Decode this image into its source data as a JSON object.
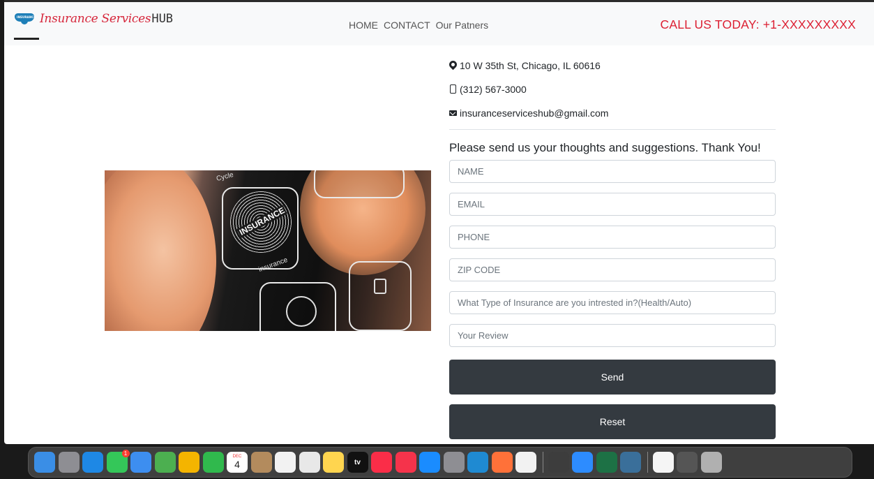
{
  "navbar": {
    "brand_script": "Insurance Services",
    "brand_hub": "HUB",
    "logo_tag": "INSURANCE",
    "links": [
      "HOME",
      "CONTACT",
      "Our Patners"
    ],
    "phone_cta": "CALL US TODAY: +1-XXXXXXXXX"
  },
  "hero": {
    "cycle_text": "Cycle",
    "insurance_badge": "INSURANCE",
    "insurance_sub": "insurance"
  },
  "contact": {
    "address": "10 W 35th St, Chicago, IL 60616",
    "phone": "(312) 567-3000",
    "email": "insuranceserviceshub@gmail.com",
    "icons": [
      "map-marker-icon",
      "mobile-icon",
      "envelope-icon"
    ]
  },
  "form": {
    "title": "Please send us your thoughts and suggestions. Thank You!",
    "name_placeholder": "NAME",
    "email_placeholder": "EMAIL",
    "phone_placeholder": "PHONE",
    "zip_placeholder": "ZIP CODE",
    "type_placeholder": "What Type of Insurance are you intrested in?(Health/Auto)",
    "review_placeholder": "Your Review",
    "send_label": "Send",
    "reset_label": "Reset"
  },
  "dock": {
    "calendar_month": "DEC",
    "calendar_day": "4",
    "messages_badge": "1",
    "tv_label": "tv",
    "apps": [
      {
        "name": "finder-icon",
        "color": "#3a8ee6"
      },
      {
        "name": "launchpad-icon",
        "color": "#8e8e93"
      },
      {
        "name": "safari-icon",
        "color": "#1e88e5"
      },
      {
        "name": "messages-icon",
        "color": "#34c759"
      },
      {
        "name": "mail-icon",
        "color": "#3d8ef0"
      },
      {
        "name": "maps-icon",
        "color": "#4caf50"
      },
      {
        "name": "photos-icon",
        "color": "#f4b400"
      },
      {
        "name": "facetime-icon",
        "color": "#30b94d"
      },
      {
        "name": "calendar-icon",
        "color": "#ffffff"
      },
      {
        "name": "contacts-icon",
        "color": "#b38b5d"
      },
      {
        "name": "reminders-icon",
        "color": "#f2f2f2"
      },
      {
        "name": "screenshot-icon",
        "color": "#e8e8e8"
      },
      {
        "name": "notes-icon",
        "color": "#ffd54f"
      },
      {
        "name": "apple-tv-icon",
        "color": "#111111"
      },
      {
        "name": "music-icon",
        "color": "#fa2d48"
      },
      {
        "name": "news-icon",
        "color": "#f5334b"
      },
      {
        "name": "app-store-icon",
        "color": "#1a8cff"
      },
      {
        "name": "system-preferences-icon",
        "color": "#8e8e93"
      },
      {
        "name": "vscode-icon",
        "color": "#1f8ad2"
      },
      {
        "name": "firefox-icon",
        "color": "#ff7139"
      },
      {
        "name": "chrome-icon",
        "color": "#f2f2f2"
      },
      {
        "name": "sublime-icon",
        "color": "#3d3d3d"
      },
      {
        "name": "zoom-icon",
        "color": "#2d8cff"
      },
      {
        "name": "excel-icon",
        "color": "#1d7145"
      },
      {
        "name": "mysql-workbench-icon",
        "color": "#3a6f9a"
      },
      {
        "name": "document-icon",
        "color": "#f5f5f5"
      },
      {
        "name": "downloads-stack-icon",
        "color": "#555555"
      },
      {
        "name": "trash-icon",
        "color": "#b0b0b0"
      }
    ]
  }
}
